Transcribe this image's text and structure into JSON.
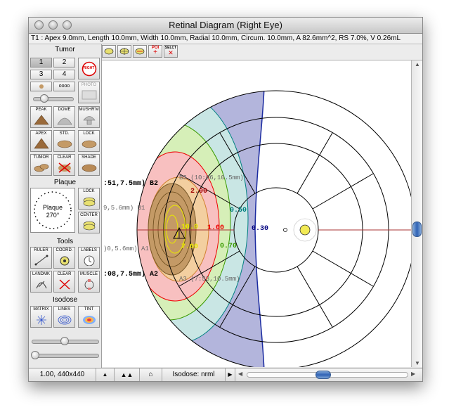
{
  "window": {
    "title": "Retinal Diagram (Right Eye)"
  },
  "info": {
    "text": "T1 : Apex 9.0mm, Length 10.0mm, Width 10.0mm, Radial 10.0mm, Circum. 10.0mm, A 82.6mm^2, RS 7.0%, V 0.26mL"
  },
  "palette": {
    "tumor_header": "Tumor",
    "tumor_numbers": [
      "1",
      "2",
      "3",
      "4"
    ],
    "eye_badge": "RIGHT",
    "photo_label": "PHOTO",
    "shape_buttons": [
      "PEAK",
      "DOME",
      "MUSHR'M",
      "APEX",
      "STD.",
      "LOCK",
      "TUMOR",
      "CLEAR",
      "SHADE"
    ],
    "plaque_header": "Plaque",
    "plaque_dial_label": "Plaque",
    "plaque_angle": "270°",
    "plaque_lock_label": "LOCK",
    "plaque_center_label": "CENTER",
    "tools_header": "Tools",
    "tool_buttons": [
      "RULER",
      "COORD.",
      "LABELS",
      "LANDMK",
      "CLEAR",
      "MUSCLE"
    ],
    "isodose_header": "Isodose",
    "isodose_buttons": [
      "MATRIX",
      "LINES",
      "TINT"
    ]
  },
  "toolbar": {
    "buttons": [
      "",
      "",
      "",
      "POI",
      "SELCT"
    ]
  },
  "diagram": {
    "isodose_labels": [
      "10.0",
      "7.00",
      "2.00",
      "1.00",
      "0.70",
      "0.50",
      "0.30"
    ],
    "coord_labels": [
      ":51,7.5mm) B2",
      "9,5.6mm) B1",
      ")0,5.6mm) A1",
      ":08,7.5mm) A2",
      "B3 (10:06,10.5mm)",
      "A3 (7:53,10.5mm)"
    ],
    "colors": {
      "c030": "#b3b5dc",
      "c050": "#c9e6e4",
      "c070": "#d6efb8",
      "c100": "#f8c0c0",
      "c200": "#f3cfa0",
      "tumor": "#c49a66",
      "line030": "#1a2aa0",
      "text030": "#000080",
      "text050": "#008080",
      "text070": "#3a9a00",
      "text100": "#ee0000",
      "text200": "#a00000",
      "text700": "#e8e800",
      "text1000": "#e8e800"
    }
  },
  "status": {
    "zoom": "1.00, 440x440",
    "isodose": "Isodose: nrml"
  }
}
